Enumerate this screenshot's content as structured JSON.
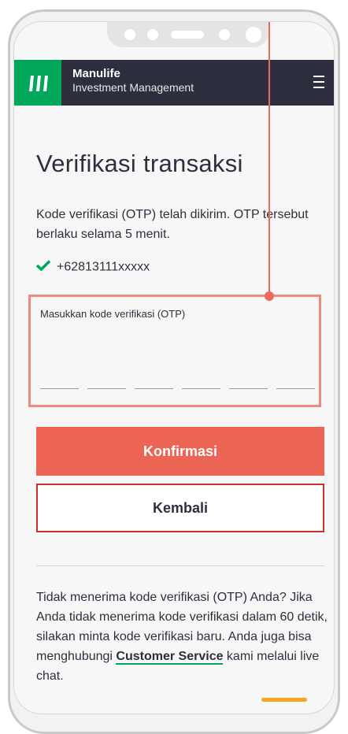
{
  "header": {
    "brand_name": "Manulife",
    "brand_subtitle": "Investment Management",
    "menu_icon": "hamburger-menu-icon"
  },
  "page": {
    "title": "Verifikasi transaksi",
    "message": "Kode verifikasi (OTP) telah dikirim. OTP tersebut berlaku selama 5 menit.",
    "phone_number": "+62813111xxxxx"
  },
  "otp": {
    "label": "Masukkan kode verifikasi (OTP)",
    "digits": [
      "",
      "",
      "",
      "",
      "",
      ""
    ]
  },
  "buttons": {
    "confirm_label": "Konfirmasi",
    "back_label": "Kembali"
  },
  "help": {
    "text_before": "Tidak menerima kode verifikasi (OTP) Anda? Jika Anda tidak menerima kode verifikasi dalam 60 detik, silakan minta kode verifikasi baru. Anda juga bisa menghubungi ",
    "link_label": "Customer Service",
    "text_after": " kami melalui live chat."
  },
  "colors": {
    "header_bg": "#2e2f3e",
    "brand_green": "#00a758",
    "primary_button": "#ec6453",
    "callout": "#ec6a5c"
  }
}
